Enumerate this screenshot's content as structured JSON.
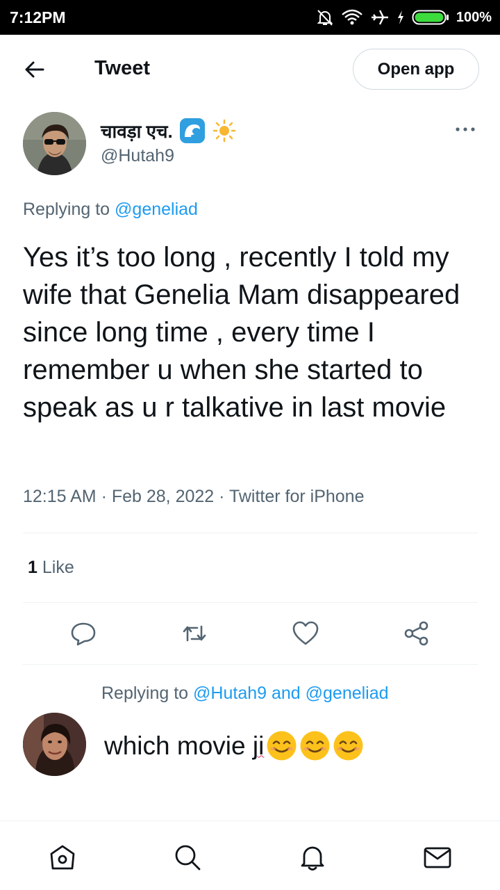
{
  "status_bar": {
    "time": "7:12PM",
    "battery": "100%",
    "icons": [
      "mute-bell-icon",
      "wifi-icon",
      "airplane-icon",
      "charging-bolt-icon",
      "battery-icon"
    ],
    "battery_color": "#3ddc3d"
  },
  "header": {
    "title": "Tweet",
    "open_app_label": "Open app",
    "back_icon": "arrow-left-icon"
  },
  "tweet": {
    "author_name": "चावड़ा एच.",
    "author_handle": "@Hutah9",
    "author_emojis": [
      "water-wave-icon",
      "sun-icon"
    ],
    "replying_prefix": "Replying to",
    "replying_handle": "@geneliad",
    "text": "Yes it’s too long , recently I told my wife that Genelia Mam disappeared since long time , every time I remember u when she started to speak as u r talkative in last movie",
    "meta": "12:15 AM · Feb 28, 2022 · Twitter for iPhone",
    "likes_count": "1",
    "likes_label": "Like",
    "actions": [
      "reply-icon",
      "retweet-icon",
      "like-icon",
      "share-icon"
    ]
  },
  "reply": {
    "replying_prefix": "Replying to",
    "replying_handles": "@Hutah9 and @geneliad",
    "text": "which movie ",
    "text_underlined": "ji",
    "emojis": [
      "smiling-face-icon",
      "smiling-face-icon",
      "smiling-face-icon"
    ]
  },
  "bottom_nav": [
    "home-icon",
    "search-icon",
    "notifications-icon",
    "messages-icon"
  ],
  "colors": {
    "link": "#1d9bf0",
    "secondary_text": "#536471",
    "primary_text": "#0f1419"
  }
}
